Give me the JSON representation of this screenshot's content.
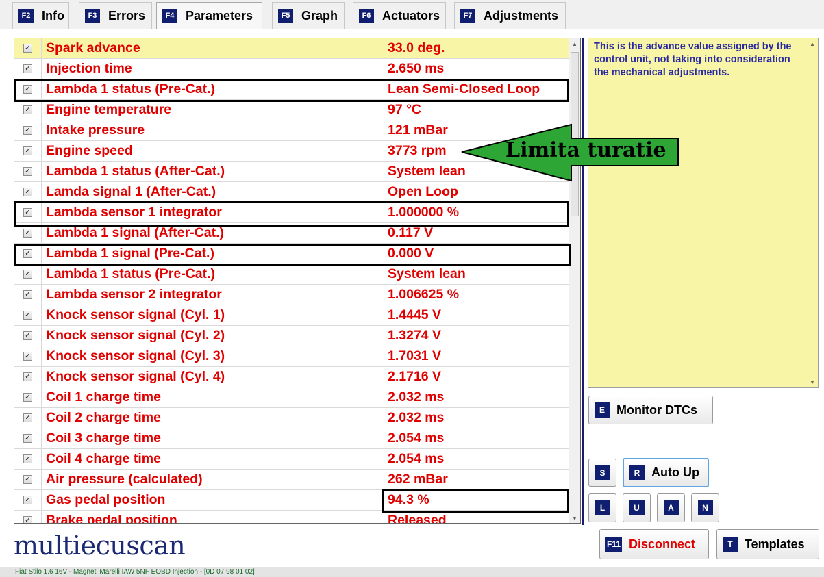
{
  "tabs": [
    {
      "key": "F2",
      "label": "Info",
      "active": false
    },
    {
      "key": "F3",
      "label": "Errors",
      "active": false
    },
    {
      "key": "F4",
      "label": "Parameters",
      "active": true
    },
    {
      "key": "F5",
      "label": "Graph",
      "active": false
    },
    {
      "key": "F6",
      "label": "Actuators",
      "active": false
    },
    {
      "key": "F7",
      "label": "Adjustments",
      "active": false
    }
  ],
  "parameters": [
    {
      "name": "Spark advance",
      "value": "33.0 deg.",
      "checked": true,
      "selected": true
    },
    {
      "name": "Injection time",
      "value": "2.650 ms",
      "checked": true
    },
    {
      "name": "Lambda 1 status (Pre-Cat.)",
      "value": "Lean Semi-Closed Loop",
      "checked": true
    },
    {
      "name": "Engine temperature",
      "value": "97 °C",
      "checked": true
    },
    {
      "name": "Intake pressure",
      "value": "121 mBar",
      "checked": true
    },
    {
      "name": "Engine speed",
      "value": "3773 rpm",
      "checked": true
    },
    {
      "name": "Lambda 1 status (After-Cat.)",
      "value": "System lean",
      "checked": true
    },
    {
      "name": "Lamda signal 1 (After-Cat.)",
      "value": "Open Loop",
      "checked": true
    },
    {
      "name": "Lambda sensor 1 integrator",
      "value": "1.000000 %",
      "checked": true
    },
    {
      "name": "Lambda 1 signal (After-Cat.)",
      "value": "0.117 V",
      "checked": true
    },
    {
      "name": "Lambda 1 signal (Pre-Cat.)",
      "value": "0.000 V",
      "checked": true
    },
    {
      "name": "Lambda 1 status (Pre-Cat.)",
      "value": "System lean",
      "checked": true
    },
    {
      "name": "Lambda sensor 2 integrator",
      "value": "1.006625 %",
      "checked": true
    },
    {
      "name": "Knock sensor signal (Cyl. 1)",
      "value": "1.4445 V",
      "checked": true
    },
    {
      "name": "Knock sensor signal (Cyl. 2)",
      "value": "1.3274 V",
      "checked": true
    },
    {
      "name": "Knock sensor signal (Cyl. 3)",
      "value": "1.7031 V",
      "checked": true
    },
    {
      "name": "Knock sensor signal (Cyl. 4)",
      "value": "2.1716 V",
      "checked": true
    },
    {
      "name": "Coil 1 charge time",
      "value": "2.032 ms",
      "checked": true
    },
    {
      "name": "Coil 2 charge time",
      "value": "2.032 ms",
      "checked": true
    },
    {
      "name": "Coil 3 charge time",
      "value": "2.054 ms",
      "checked": true
    },
    {
      "name": "Coil 4 charge time",
      "value": "2.054 ms",
      "checked": true
    },
    {
      "name": "Air pressure (calculated)",
      "value": "262 mBar",
      "checked": true
    },
    {
      "name": "Gas pedal position",
      "value": "94.3 %",
      "checked": true
    },
    {
      "name": "Brake pedal position",
      "value": "Released",
      "checked": true
    }
  ],
  "description": "This is the advance value assigned by the control unit, not taking into consideration the mechanical adjustments.",
  "buttons": {
    "monitor_dtcs": {
      "key": "E",
      "label": "Monitor DTCs"
    },
    "s": {
      "key": "S"
    },
    "auto_up": {
      "key": "R",
      "label": "Auto Up"
    },
    "l": {
      "key": "L"
    },
    "u": {
      "key": "U"
    },
    "a": {
      "key": "A"
    },
    "n": {
      "key": "N"
    },
    "disconnect": {
      "key": "F11",
      "label": "Disconnect"
    },
    "templates": {
      "key": "T",
      "label": "Templates"
    }
  },
  "annotation": {
    "label": "Limita turatie",
    "color": "#2ea636"
  },
  "logo": "multiecuscan",
  "status_bar": "Fiat Stilo 1.6 16V - Magneti Marelli IAW 5NF EOBD Injection - [0D 07 98 01 02]",
  "colors": {
    "param_text": "#e00000",
    "selected_row": "#f8f6a6",
    "key_badge": "#0f1e6e",
    "description_text": "#2a2aa0"
  }
}
